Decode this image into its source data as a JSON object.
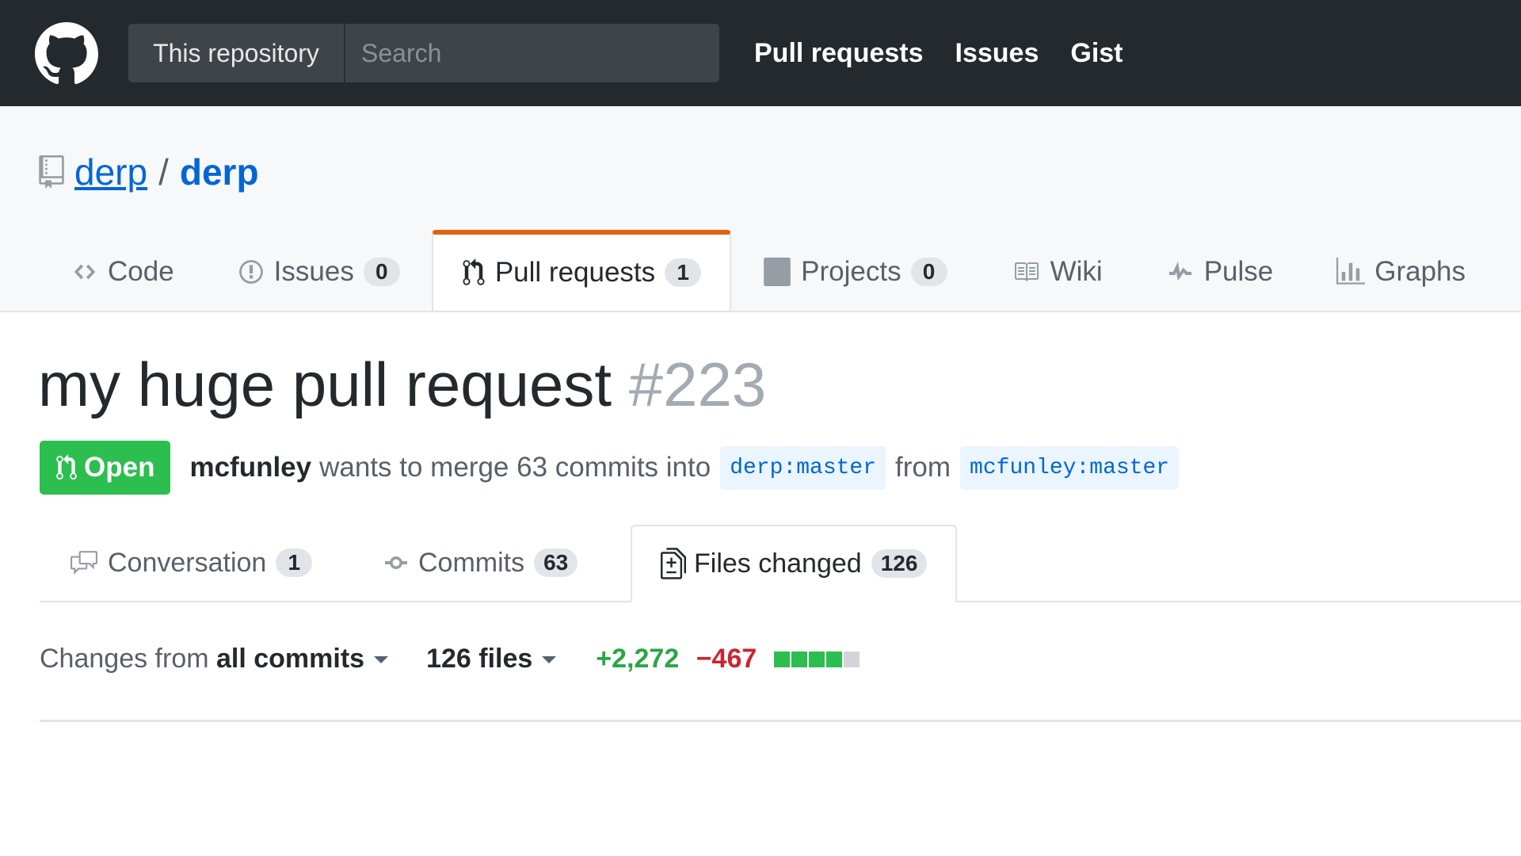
{
  "header": {
    "search_scope": "This repository",
    "search_placeholder": "Search",
    "nav": [
      "Pull requests",
      "Issues",
      "Gist"
    ]
  },
  "repo": {
    "owner": "derp",
    "separator": "/",
    "name": "derp"
  },
  "repo_nav": {
    "code": "Code",
    "issues": "Issues",
    "issues_count": "0",
    "pulls": "Pull requests",
    "pulls_count": "1",
    "projects": "Projects",
    "projects_count": "0",
    "wiki": "Wiki",
    "pulse": "Pulse",
    "graphs": "Graphs"
  },
  "pr": {
    "title": "my huge pull request",
    "number": "#223",
    "state": "Open",
    "author": "mcfunley",
    "merge_text": "wants to merge 63 commits into",
    "base_branch": "derp:master",
    "from_text": "from",
    "head_branch": "mcfunley:master"
  },
  "tabs": {
    "conversation": "Conversation",
    "conversation_count": "1",
    "commits": "Commits",
    "commits_count": "63",
    "files": "Files changed",
    "files_count": "126"
  },
  "toolbar": {
    "changes_prefix": "Changes from",
    "changes_value": "all commits",
    "files_label": "126 files",
    "additions": "+2,272",
    "deletions": "−467",
    "diffstat": [
      "added",
      "added",
      "added",
      "added",
      "neutral"
    ]
  },
  "colors": {
    "header_bg": "#24292e",
    "link": "#0366d6",
    "accent_tab": "#e36209",
    "open_green": "#2cbe4e",
    "additions": "#28a745",
    "deletions": "#cb2431",
    "diff_added": "#2cbe4e",
    "diff_neutral": "#d1d5da"
  }
}
